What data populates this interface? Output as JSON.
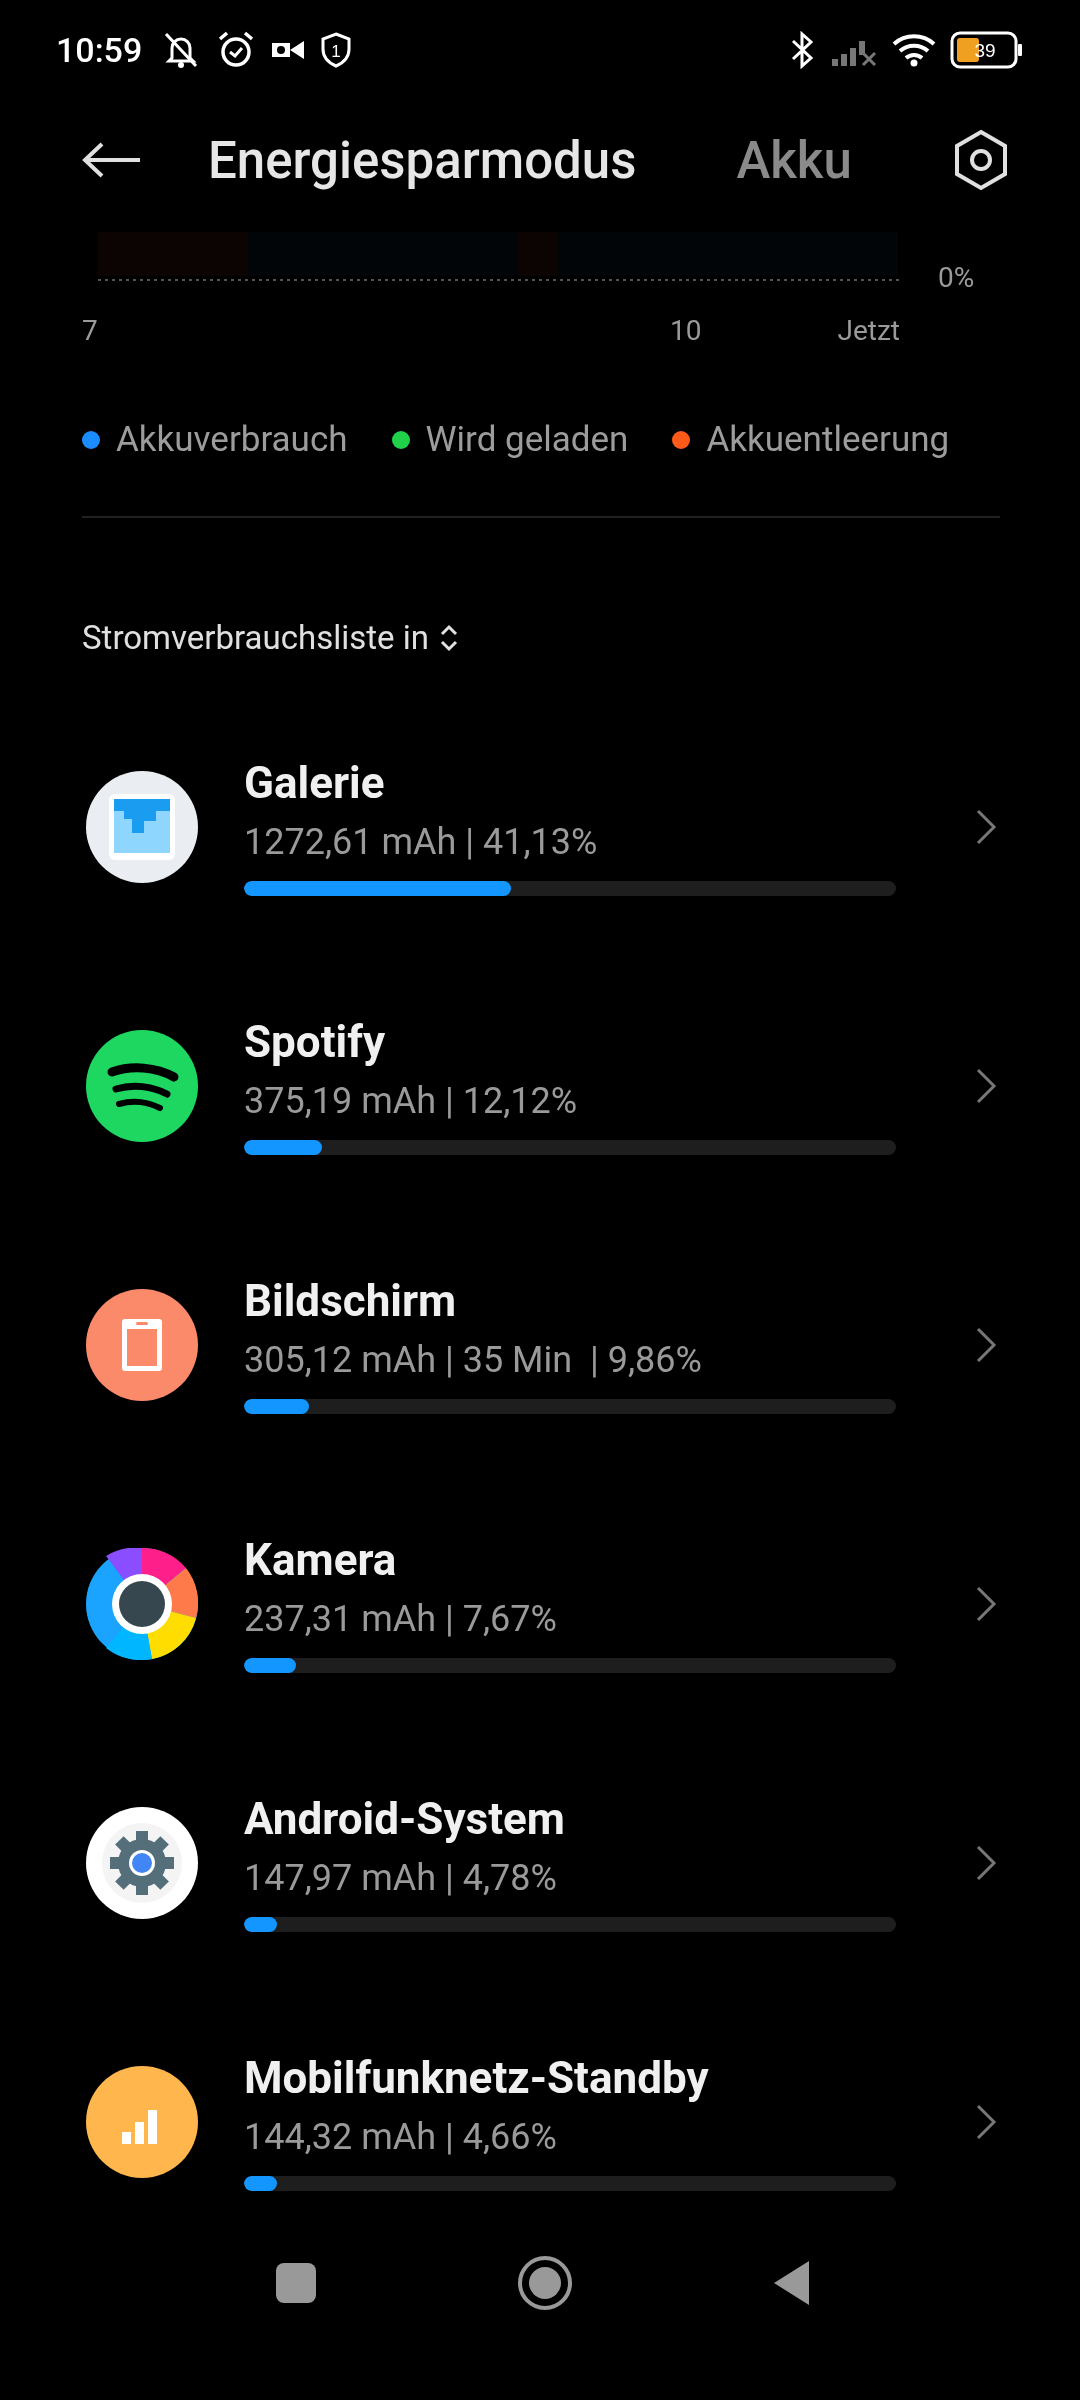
{
  "status_bar": {
    "time": "10:59",
    "notification_count": "1",
    "battery": "39"
  },
  "header": {
    "tabs": [
      {
        "label": "Energiesparmodus",
        "selected": true
      },
      {
        "label": "Akku",
        "selected": false
      }
    ]
  },
  "chart": {
    "y_label": "0%",
    "x_labels": [
      "7",
      "10",
      "Jetzt"
    ]
  },
  "legend": [
    {
      "label": "Akkuverbrauch",
      "color": "#1a8cff"
    },
    {
      "label": "Wird geladen",
      "color": "#1fd24a"
    },
    {
      "label": "Akkuentleerung",
      "color": "#ff5a1a"
    }
  ],
  "list_header": "Stromverbrauchsliste in",
  "apps": [
    {
      "kind": "gallery",
      "name": "Galerie",
      "usage": "1272,61 mAh | 41,13%",
      "level": 0.41
    },
    {
      "kind": "spotify",
      "name": "Spotify",
      "usage": "375,19 mAh | 12,12%",
      "level": 0.12
    },
    {
      "kind": "screen",
      "name": "Bildschirm",
      "usage": "305,12 mAh | 35 Min  | 9,86%",
      "level": 0.1
    },
    {
      "kind": "camera",
      "name": "Kamera",
      "usage": "237,31 mAh | 7,67%",
      "level": 0.08
    },
    {
      "kind": "system",
      "name": "Android-System",
      "usage": "147,97 mAh | 4,78%",
      "level": 0.05
    },
    {
      "kind": "cellular",
      "name": "Mobilfunknetz-Standby",
      "usage": "144,32 mAh | 4,66%",
      "level": 0.05
    }
  ]
}
